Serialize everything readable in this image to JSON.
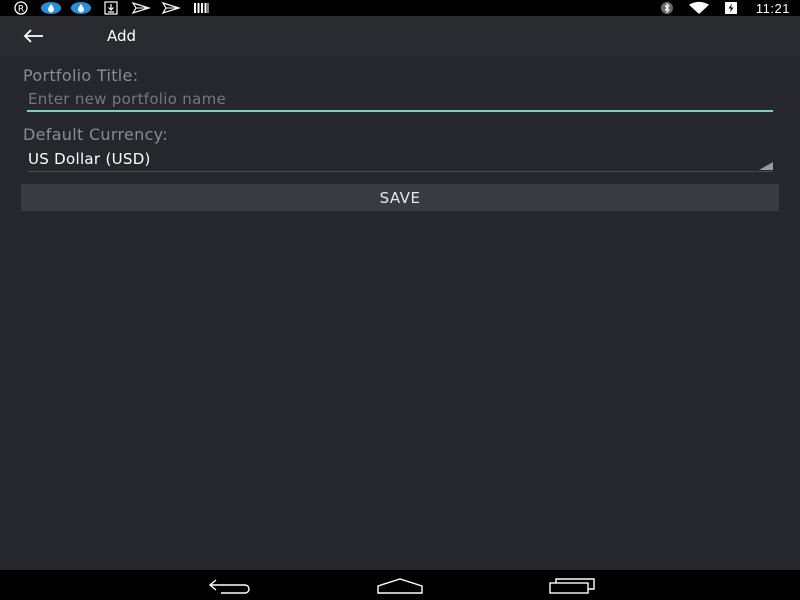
{
  "status_bar": {
    "left_icons": [
      "registered-icon",
      "app-drop-icon",
      "app-drop-icon",
      "download-icon",
      "send-icon",
      "send-icon",
      "barcode-icon"
    ],
    "right_icons": [
      "bluetooth-icon",
      "wifi-icon",
      "battery-charging-icon"
    ],
    "time": "11:21"
  },
  "app_bar": {
    "back_icon": "arrow-left-icon",
    "title": "Add"
  },
  "form": {
    "title_label": "Portfolio Title:",
    "title_placeholder": "Enter new portfolio name",
    "title_value": "",
    "currency_label": "Default Currency:",
    "currency_value": "US Dollar (USD)",
    "save_label": "SAVE"
  },
  "nav_bar": {
    "buttons": [
      "back-icon",
      "home-icon",
      "recents-icon"
    ]
  },
  "colors": {
    "background": "#26272c",
    "app_bar": "#2a2b30",
    "accent_underline": "#80cbc4",
    "button_bg": "#3a3b41",
    "label_text": "#8b8c90"
  }
}
